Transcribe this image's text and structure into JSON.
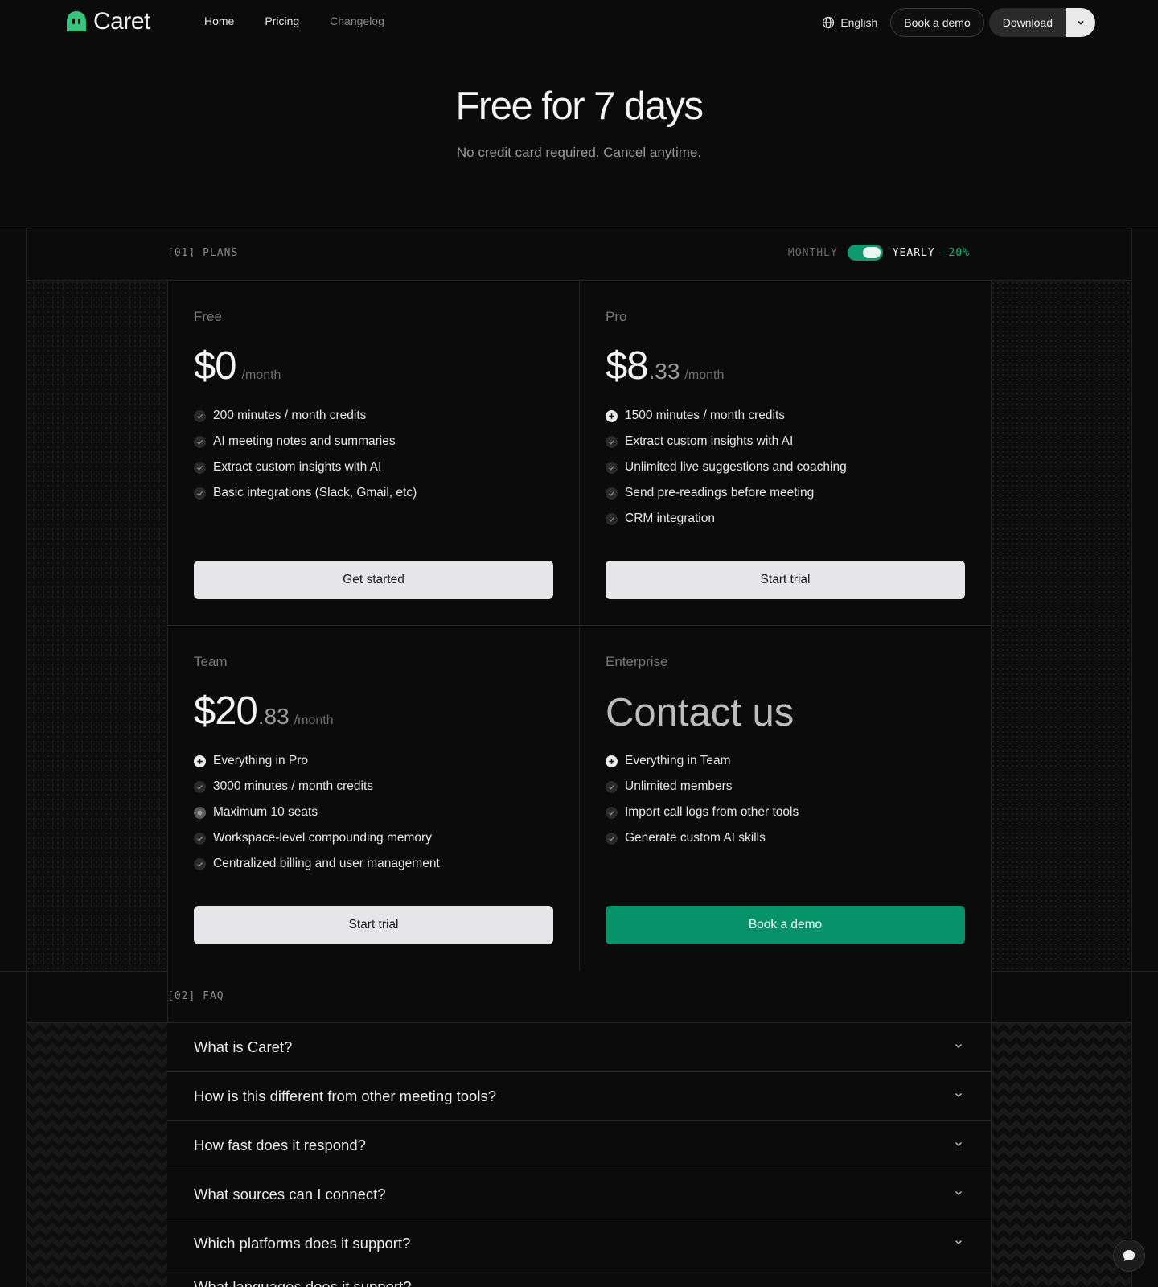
{
  "nav": {
    "brand": "Caret",
    "links": [
      "Home",
      "Pricing",
      "Changelog"
    ],
    "language": "English",
    "book_demo": "Book a demo",
    "download": "Download"
  },
  "hero": {
    "title": "Free for 7 days",
    "subtitle": "No credit card required. Cancel anytime."
  },
  "plans_section": {
    "label": "[01] PLANS",
    "billing_monthly": "MONTHLY",
    "billing_yearly": "YEARLY",
    "yearly_discount": "-20%",
    "yearly_selected": true
  },
  "plans": [
    {
      "name": "Free",
      "price": "$0",
      "cents": "",
      "per": "/month",
      "features": [
        {
          "icon": "check",
          "text": "200 minutes / month credits"
        },
        {
          "icon": "check",
          "text": "AI meeting notes and summaries"
        },
        {
          "icon": "check",
          "text": "Extract custom insights with AI"
        },
        {
          "icon": "check",
          "text": "Basic integrations (Slack, Gmail, etc)"
        }
      ],
      "cta": "Get started"
    },
    {
      "name": "Pro",
      "price": "$8",
      "cents": ".33",
      "per": "/month",
      "features": [
        {
          "icon": "plus",
          "text": "1500 minutes / month credits"
        },
        {
          "icon": "check",
          "text": "Extract custom insights with AI"
        },
        {
          "icon": "check",
          "text": "Unlimited live suggestions and coaching"
        },
        {
          "icon": "check",
          "text": "Send pre-readings before meeting"
        },
        {
          "icon": "check",
          "text": "CRM integration"
        }
      ],
      "cta": "Start trial"
    },
    {
      "name": "Team",
      "price": "$20",
      "cents": ".83",
      "per": "/month",
      "features": [
        {
          "icon": "plus",
          "text": "Everything in Pro"
        },
        {
          "icon": "check",
          "text": "3000 minutes / month credits"
        },
        {
          "icon": "dot",
          "text": "Maximum 10 seats"
        },
        {
          "icon": "check",
          "text": "Workspace-level compounding memory"
        },
        {
          "icon": "check",
          "text": "Centralized billing and user management"
        }
      ],
      "cta": "Start trial"
    },
    {
      "name": "Enterprise",
      "contact": "Contact us",
      "features": [
        {
          "icon": "plus",
          "text": "Everything in Team"
        },
        {
          "icon": "check",
          "text": "Unlimited members"
        },
        {
          "icon": "check",
          "text": "Import call logs from other tools"
        },
        {
          "icon": "check",
          "text": "Generate custom AI skills"
        }
      ],
      "cta": "Book a demo"
    }
  ],
  "faq_section": {
    "label": "[02] FAQ",
    "questions": [
      "What is Caret?",
      "How is this different from other meeting tools?",
      "How fast does it respond?",
      "What sources can I connect?",
      "Which platforms does it support?",
      "What languages does it support?"
    ]
  },
  "colors": {
    "background": "#0b0b0b",
    "accent_green": "#07936a",
    "discount_green": "#1fb57a",
    "logo_green": "#34c47c"
  }
}
